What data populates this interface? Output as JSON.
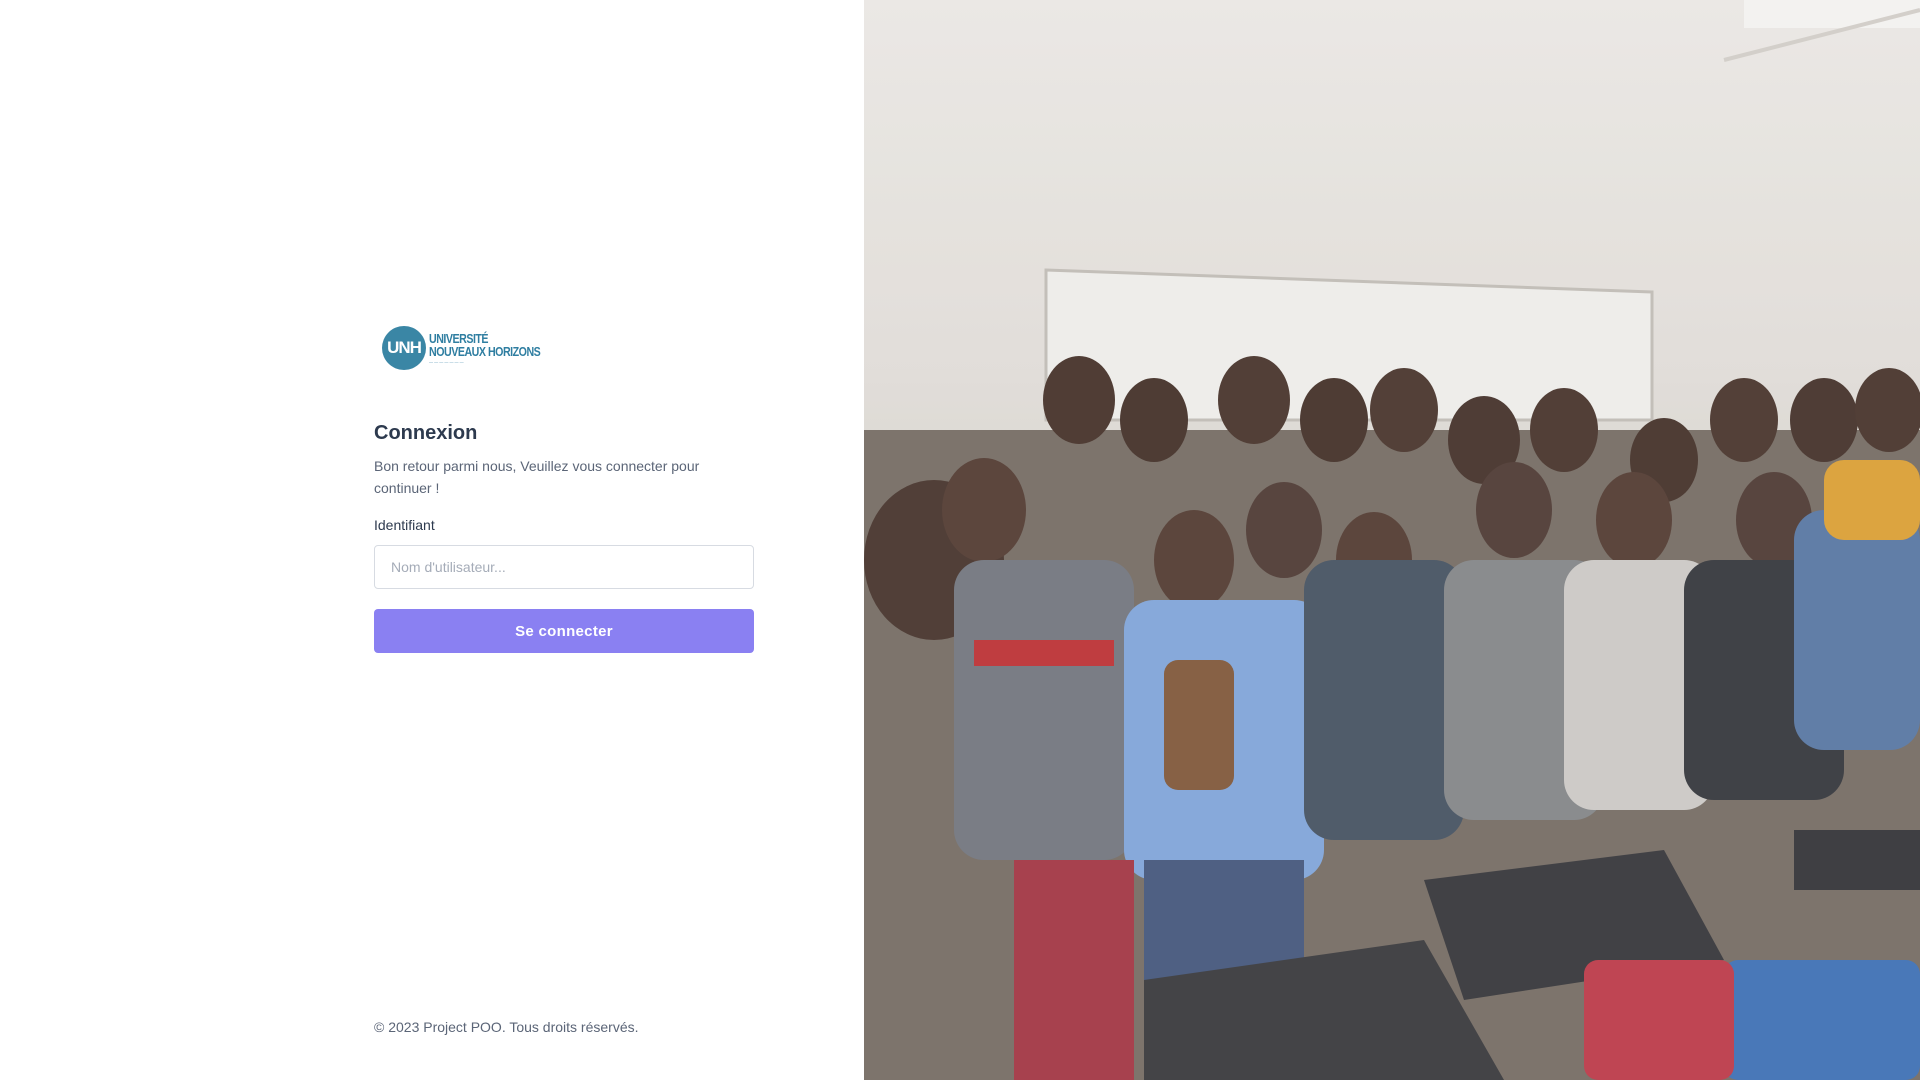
{
  "brand": {
    "logo_mark": "UNH",
    "logo_line1": "UNIVERSITÉ",
    "logo_line2": "NOUVEAUX HORIZONS",
    "accent_color": "#3a86a5"
  },
  "login": {
    "title": "Connexion",
    "subtitle": "Bon retour parmi nous, Veuillez vous connecter pour continuer !",
    "username_label": "Identifiant",
    "username_placeholder": "Nom d'utilisateur...",
    "username_value": "",
    "submit_label": "Se connecter",
    "button_color": "#8a80f2"
  },
  "footer": {
    "copyright": "© 2023 Project POO. Tous droits réservés."
  },
  "hero": {
    "image_icon": "group-photo"
  }
}
